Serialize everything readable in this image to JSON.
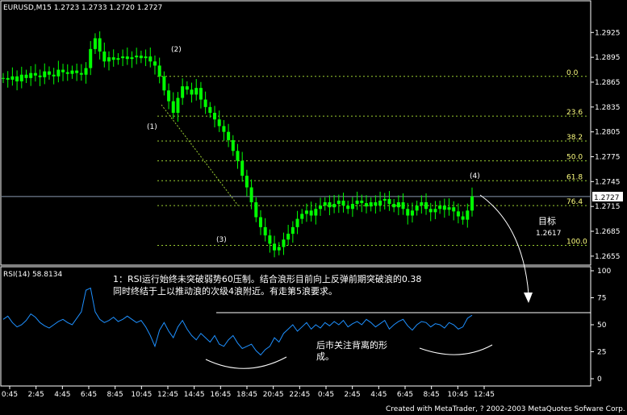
{
  "symbol_header": "EURUSD,M15  1.2723 1.2733 1.2720 1.2727",
  "rsi_header": "RSI(14)  58.8134",
  "footer": "Created with MetaTrader, ? 2002-2003 MetaQuotes Sofware Corp.",
  "current_price_tag": "1.2727",
  "annotations": {
    "w1": "(1)",
    "w2": "(2)",
    "w3": "(3)",
    "w4": "(4)",
    "target_label": "目标",
    "target_value": "1.2617",
    "note_line1": "1：RSI运行始终未突破弱势60压制。结合浪形目前向上反弹前期突破浪的0.38",
    "note_line2": "同时终结于上以推动浪的次级4浪附近。有走第5浪要求。",
    "note_rsi_line1": "后市关注背离的形",
    "note_rsi_line2": "成。"
  },
  "colors": {
    "background": "#000000",
    "candles": "#00ff00",
    "rsi_line": "#1e90ff",
    "fib_lines": "#9acd32",
    "fib_text": "#ffff80",
    "grid": "#ffffff"
  },
  "chart_data": [
    {
      "type": "candlestick",
      "title": "EURUSD,M15",
      "ohlc_last": {
        "open": 1.2723,
        "high": 1.2733,
        "low": 1.272,
        "close": 1.2727
      },
      "y_ticks": [
        "1.2925",
        "1.2895",
        "1.2865",
        "1.2835",
        "1.2805",
        "1.2775",
        "1.2745",
        "1.2715",
        "1.2685",
        "1.2655"
      ],
      "ylim": [
        1.265,
        1.2935
      ],
      "close_series": [
        1.287,
        1.2868,
        1.2872,
        1.2866,
        1.2874,
        1.287,
        1.2876,
        1.2873,
        1.2871,
        1.2878,
        1.2874,
        1.2872,
        1.288,
        1.2877,
        1.2875,
        1.2879,
        1.2876,
        1.2874,
        1.2882,
        1.2905,
        1.2918,
        1.2902,
        1.289,
        1.2895,
        1.2892,
        1.2894,
        1.2896,
        1.2893,
        1.2895,
        1.2897,
        1.2894,
        1.2896,
        1.289,
        1.2885,
        1.2872,
        1.2855,
        1.2842,
        1.2828,
        1.2846,
        1.286,
        1.2856,
        1.285,
        1.2858,
        1.2844,
        1.2835,
        1.2828,
        1.282,
        1.2812,
        1.2805,
        1.2795,
        1.2782,
        1.277,
        1.2752,
        1.2738,
        1.272,
        1.2702,
        1.269,
        1.268,
        1.267,
        1.2662,
        1.2666,
        1.2675,
        1.2682,
        1.269,
        1.27,
        1.2706,
        1.271,
        1.2704,
        1.2712,
        1.2716,
        1.272,
        1.2714,
        1.2718,
        1.2722,
        1.2716,
        1.2712,
        1.2718,
        1.2722,
        1.2719,
        1.2715,
        1.272,
        1.2716,
        1.2722,
        1.2724,
        1.2718,
        1.2714,
        1.272,
        1.2712,
        1.2704,
        1.271,
        1.2716,
        1.272,
        1.2712,
        1.2708,
        1.2712,
        1.2716,
        1.2711,
        1.2714,
        1.2709,
        1.2703,
        1.2699,
        1.271,
        1.2727
      ],
      "fib_levels": [
        {
          "label": "0.0",
          "price": 1.2872
        },
        {
          "label": "23.6",
          "price": 1.2824
        },
        {
          "label": "38.2",
          "price": 1.2794
        },
        {
          "label": "50.0",
          "price": 1.277
        },
        {
          "label": "61.8",
          "price": 1.2746
        },
        {
          "label": "76.4",
          "price": 1.2716
        },
        {
          "label": "100.0",
          "price": 1.2668
        }
      ],
      "current_price": 1.2727
    },
    {
      "type": "line",
      "title": "RSI(14)",
      "y_ticks": [
        "100",
        "75",
        "50",
        "25",
        "0"
      ],
      "ylim": [
        0,
        100
      ],
      "last_value": 58.8134,
      "values": [
        55,
        58,
        52,
        48,
        50,
        54,
        60,
        57,
        52,
        49,
        47,
        50,
        53,
        55,
        52,
        50,
        56,
        62,
        82,
        84,
        62,
        55,
        52,
        54,
        57,
        53,
        55,
        58,
        55,
        52,
        54,
        48,
        40,
        30,
        45,
        52,
        44,
        38,
        48,
        54,
        46,
        40,
        36,
        42,
        38,
        34,
        40,
        32,
        30,
        36,
        40,
        33,
        28,
        30,
        32,
        26,
        22,
        27,
        30,
        38,
        34,
        42,
        46,
        50,
        44,
        48,
        52,
        46,
        50,
        47,
        52,
        49,
        53,
        50,
        54,
        48,
        51,
        53,
        50,
        55,
        52,
        48,
        51,
        54,
        46,
        50,
        53,
        55,
        49,
        45,
        50,
        53,
        52,
        48,
        51,
        50,
        47,
        52,
        50,
        46,
        48,
        56,
        58.8
      ]
    }
  ],
  "x_ticks": [
    "0:45",
    "2:45",
    "4:45",
    "6:45",
    "8:45",
    "10:45",
    "12:45",
    "14:45",
    "16:45",
    "18:45",
    "20:45",
    "22:45",
    "0:45",
    "2:45",
    "4:45",
    "6:45",
    "8:45",
    "10:45",
    "12:45"
  ]
}
